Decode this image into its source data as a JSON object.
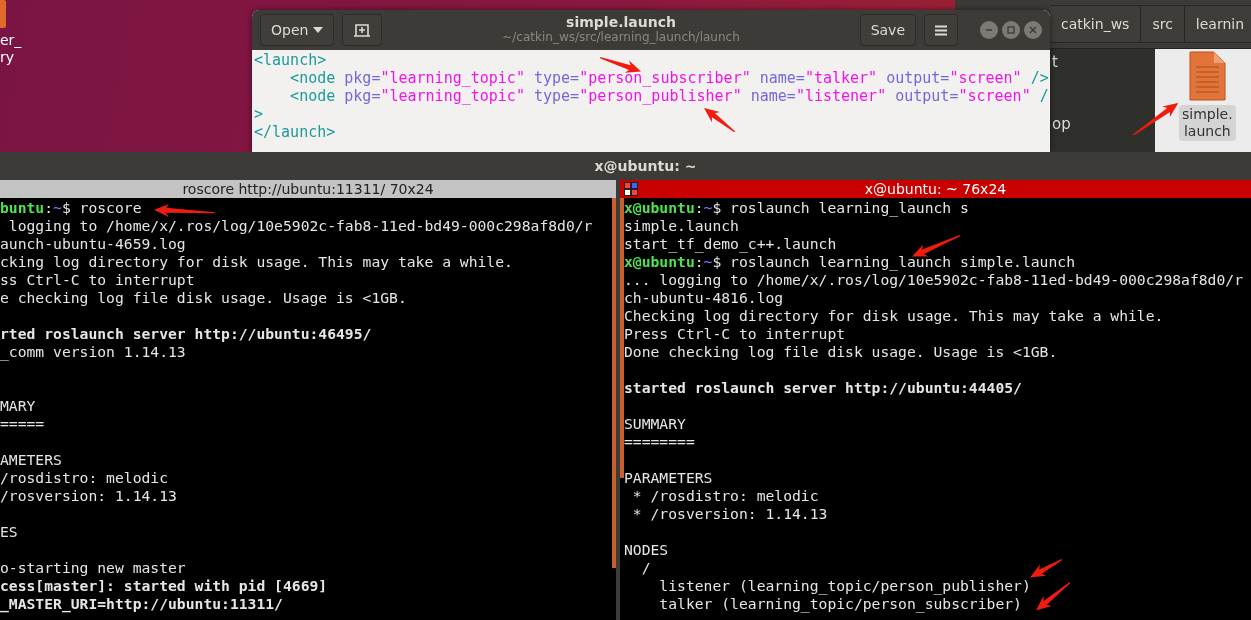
{
  "desktop_icon": {
    "label_lines": [
      "er_",
      "ry"
    ]
  },
  "file_manager": {
    "path": [
      {
        "label": "catkin_ws"
      },
      {
        "label": "src"
      },
      {
        "label": "learnin"
      }
    ],
    "sidebar": [
      {
        "label": "t"
      },
      {
        "label": "op"
      }
    ],
    "files": [
      {
        "label_lines": [
          "simple.",
          "launch"
        ],
        "selected": true
      }
    ]
  },
  "editor": {
    "open_button": "Open",
    "title": "simple.launch",
    "subtitle": "~/catkin_ws/src/learning_launch/launch",
    "save_button": "Save",
    "lines": [
      {
        "tokens": [
          {
            "text": "<launch>",
            "kind": "tag"
          }
        ]
      },
      {
        "tokens": [
          {
            "text": "    <node",
            "kind": "tag"
          },
          {
            "text": " pkg=",
            "kind": "attr"
          },
          {
            "text": "\"learning_topic\"",
            "kind": "string"
          },
          {
            "text": " type=",
            "kind": "attr"
          },
          {
            "text": "\"person_subscriber\"",
            "kind": "string"
          },
          {
            "text": " name=",
            "kind": "attr"
          },
          {
            "text": "\"talker\"",
            "kind": "string"
          },
          {
            "text": " output=",
            "kind": "attr"
          },
          {
            "text": "\"screen\"",
            "kind": "string"
          },
          {
            "text": " />",
            "kind": "tag"
          }
        ]
      },
      {
        "tokens": [
          {
            "text": "    <node",
            "kind": "tag"
          },
          {
            "text": " pkg=",
            "kind": "attr"
          },
          {
            "text": "\"learning_topic\"",
            "kind": "string"
          },
          {
            "text": " type=",
            "kind": "attr"
          },
          {
            "text": "\"person_publisher\"",
            "kind": "string"
          },
          {
            "text": " name=",
            "kind": "attr"
          },
          {
            "text": "\"listener\"",
            "kind": "string"
          },
          {
            "text": " output=",
            "kind": "attr"
          },
          {
            "text": "\"screen\"",
            "kind": "string"
          },
          {
            "text": " /",
            "kind": "tag"
          }
        ]
      },
      {
        "tokens": [
          {
            "text": ">",
            "kind": "tag"
          }
        ]
      },
      {
        "tokens": [
          {
            "text": "</launch>",
            "kind": "tag"
          }
        ]
      }
    ]
  },
  "terminal": {
    "title": "x@ubuntu: ~",
    "panes": [
      {
        "title": "roscore http://ubuntu:11311/ 70x24",
        "selected": false,
        "lines": [
          {
            "kind": "prompt",
            "user": "buntu",
            "sep": ":",
            "cwd": "~",
            "command": "$ roscore"
          },
          {
            "kind": "output",
            "text": " logging to /home/x/.ros/log/10e5902c-fab8-11ed-bd49-000c298af8d0/r",
            "bold": false
          },
          {
            "kind": "output",
            "text": "aunch-ubuntu-4659.log",
            "bold": false
          },
          {
            "kind": "output",
            "text": "cking log directory for disk usage. This may take a while.",
            "bold": false
          },
          {
            "kind": "output",
            "text": "ss Ctrl-C to interrupt",
            "bold": false
          },
          {
            "kind": "output",
            "text": "e checking log file disk usage. Usage is <1GB.",
            "bold": false
          },
          {
            "kind": "blank"
          },
          {
            "kind": "output",
            "text": "rted roslaunch server http://ubuntu:46495/",
            "bold": true
          },
          {
            "kind": "output",
            "text": "_comm version 1.14.13",
            "bold": false
          },
          {
            "kind": "blank"
          },
          {
            "kind": "blank"
          },
          {
            "kind": "output",
            "text": "MARY",
            "bold": false
          },
          {
            "kind": "output",
            "text": "=====",
            "bold": false
          },
          {
            "kind": "blank"
          },
          {
            "kind": "output",
            "text": "AMETERS",
            "bold": false
          },
          {
            "kind": "output",
            "text": "/rosdistro: melodic",
            "bold": false
          },
          {
            "kind": "output",
            "text": "/rosversion: 1.14.13",
            "bold": false
          },
          {
            "kind": "blank"
          },
          {
            "kind": "output",
            "text": "ES",
            "bold": false
          },
          {
            "kind": "blank"
          },
          {
            "kind": "output",
            "text": "o-starting new master",
            "bold": false
          },
          {
            "kind": "output",
            "text": "cess[master]: started with pid [4669]",
            "bold": true
          },
          {
            "kind": "output",
            "text": "_MASTER_URI=http://ubuntu:11311/",
            "bold": true
          }
        ]
      },
      {
        "title": "x@ubuntu: ~ 76x24",
        "selected": true,
        "lines": [
          {
            "kind": "prompt",
            "user": "x@ubuntu",
            "sep": ":",
            "cwd": "~",
            "command": "$ roslaunch learning_launch s"
          },
          {
            "kind": "output",
            "text": "simple.launch",
            "bold": false
          },
          {
            "kind": "output",
            "text": "start_tf_demo_c++.launch",
            "bold": false
          },
          {
            "kind": "prompt",
            "user": "x@ubuntu",
            "sep": ":",
            "cwd": "~",
            "command": "$ roslaunch learning_launch simple.launch"
          },
          {
            "kind": "output",
            "text": "... logging to /home/x/.ros/log/10e5902c-fab8-11ed-bd49-000c298af8d0/r",
            "bold": false
          },
          {
            "kind": "output",
            "text": "ch-ubuntu-4816.log",
            "bold": false
          },
          {
            "kind": "output",
            "text": "Checking log directory for disk usage. This may take a while.",
            "bold": false
          },
          {
            "kind": "output",
            "text": "Press Ctrl-C to interrupt",
            "bold": false
          },
          {
            "kind": "output",
            "text": "Done checking log file disk usage. Usage is <1GB.",
            "bold": false
          },
          {
            "kind": "blank"
          },
          {
            "kind": "output",
            "text": "started roslaunch server http://ubuntu:44405/",
            "bold": true
          },
          {
            "kind": "blank"
          },
          {
            "kind": "output",
            "text": "SUMMARY",
            "bold": false
          },
          {
            "kind": "output",
            "text": "========",
            "bold": false
          },
          {
            "kind": "blank"
          },
          {
            "kind": "output",
            "text": "PARAMETERS",
            "bold": false
          },
          {
            "kind": "output",
            "text": " * /rosdistro: melodic",
            "bold": false
          },
          {
            "kind": "output",
            "text": " * /rosversion: 1.14.13",
            "bold": false
          },
          {
            "kind": "blank"
          },
          {
            "kind": "output",
            "text": "NODES",
            "bold": false
          },
          {
            "kind": "output",
            "text": "  /",
            "bold": false
          },
          {
            "kind": "output",
            "text": "    listener (learning_topic/person_publisher)",
            "bold": false
          },
          {
            "kind": "output",
            "text": "    talker (learning_topic/person_subscriber)",
            "bold": false
          }
        ]
      }
    ]
  }
}
